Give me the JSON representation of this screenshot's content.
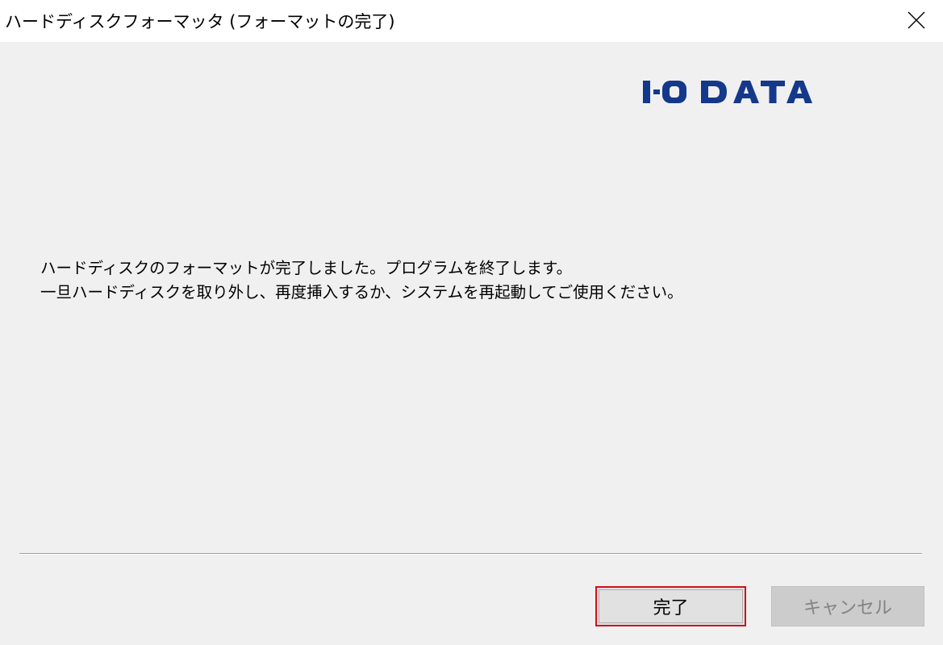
{
  "window": {
    "title": "ハードディスクフォーマッタ (フォーマットの完了)",
    "close_icon": "close-icon"
  },
  "logo": {
    "text": "I-O DATA",
    "color": "#14398a"
  },
  "message": {
    "line1": "ハードディスクのフォーマットが完了しました。プログラムを終了します。",
    "line2": "一旦ハードディスクを取り外し、再度挿入するか、システムを再起動してご使用ください。"
  },
  "buttons": {
    "finish_label": "完了",
    "cancel_label": "キャンセル",
    "cancel_enabled": false,
    "focus_highlight_color": "#d0101f"
  }
}
